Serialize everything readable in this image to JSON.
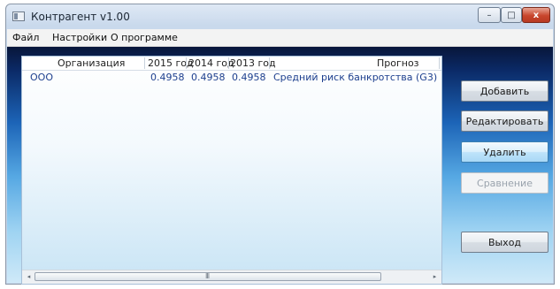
{
  "window": {
    "title": "Контрагент v1.00",
    "controls": {
      "minimize": "–",
      "maximize": "□",
      "close": "x"
    }
  },
  "menu": [
    "Файл",
    "Настройки",
    "О программе"
  ],
  "table": {
    "columns": [
      "Организация",
      "2015 год",
      "2014 год",
      "2013 год",
      "Прогноз"
    ],
    "rows": [
      [
        "ООО",
        "0.4958",
        "0.4958",
        "0.4958",
        "Средний риск банкротства (G3)"
      ]
    ]
  },
  "scrollbar": {
    "left_arrow": "◂",
    "right_arrow": "▸",
    "grip": "III"
  },
  "buttons": {
    "add": "Добавить",
    "edit": "Редактировать",
    "delete": "Удалить",
    "compare": "Сравнение",
    "exit": "Выход"
  }
}
